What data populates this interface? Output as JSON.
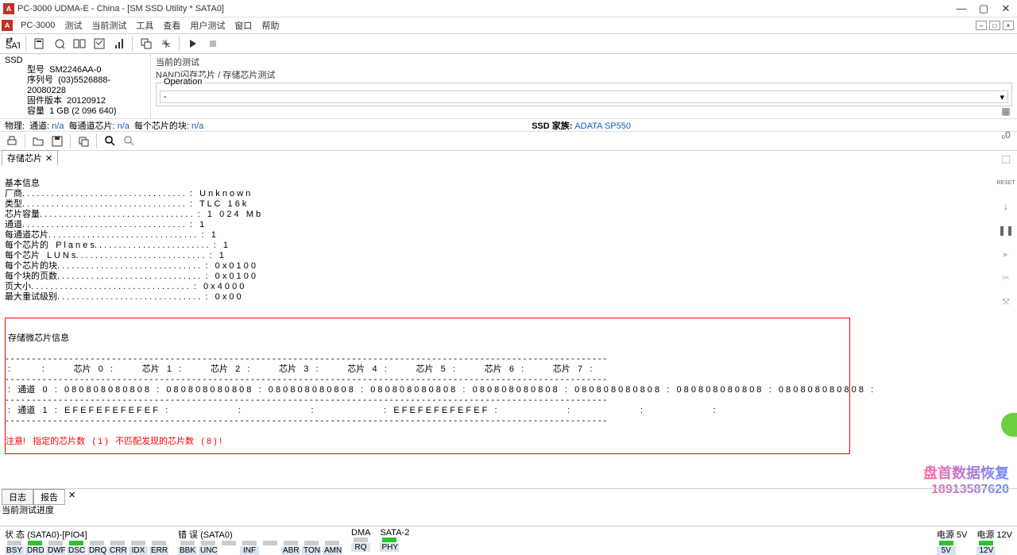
{
  "window": {
    "title": "PC-3000 UDMA-E - China - [SM SSD Utility * SATA0]",
    "minimize": "—",
    "maximize": "▢",
    "close": "✕"
  },
  "menu": {
    "app": "PC-3000",
    "items": [
      "测试",
      "当前测试",
      "工具",
      "查看",
      "用户测试",
      "窗口",
      "帮助"
    ]
  },
  "ssd_panel": {
    "label": "SSD",
    "model_k": "型号",
    "model_v": "SM2246AA-0",
    "serial_k": "序列号",
    "serial_v": "(03)5526888-20080228",
    "fw_k": "固件版本",
    "fw_v": "20120912",
    "cap_k": "容量",
    "cap_v": "1 GB (2 096 640)"
  },
  "right_panel": {
    "current_test": "当前的测试",
    "path": "NAND闪存芯片 / 存储芯片测试",
    "operation": "Operation",
    "op_val": "-"
  },
  "phys": {
    "label": "物理:",
    "ch": "通道:",
    "ch_v": "n/a",
    "per": "每通道芯片:",
    "per_v": "n/a",
    "blk": "每个芯片的块:",
    "blk_v": "n/a",
    "ssd_family": "SSD 家族:",
    "family_link": "ADATA SP550"
  },
  "tab": {
    "name": "存储芯片",
    "x": "✕"
  },
  "console": {
    "header": "基本信息",
    "lines": [
      "厂商. . . . . . . . . . . . . . . . . . . . . . . . . . . . . . . . . .  :   U n k n o w n",
      "类型. . . . . . . . . . . . . . . . . . . . . . . . . . . . . . . . . .  :   T L C   1 6 k",
      "芯片容量. . . . . . . . . . . . . . . . . . . . . . . . . . . . . . . .  :   1   0 2 4   M b",
      "通道. . . . . . . . . . . . . . . . . . . . . . . . . . . . . . . . . .  :   1",
      "每通道芯片. . . . . . . . . . . . . . . . . . . . . . . . . . . . . . .  :   1",
      "每个芯片的   P l a n e s. . . . . . . . . . . . . . . . . . . . . . . .  :   1",
      "每个芯片   L U N s. . . . . . . . . . . . . . . . . . . . . . . . . . .  :   1",
      "每个芯片的块. . . . . . . . . . . . . . . . . . . . . . . . . . . . . .  :   0 x 0 1 0 0",
      "每个块的页数. . . . . . . . . . . . . . . . . . . . . . . . . . . . . .  :   0 x 0 1 0 0",
      "页大小. . . . . . . . . . . . . . . . . . . . . . . . . . . . . . . . .  :   0 x 4 0 0 0",
      "最大重试级别. . . . . . . . . . . . . . . . . . . . . . . . . . . . . .  :   0 x 0 0"
    ],
    "box_title": "存储微芯片信息",
    "box_lines": [
      "- - - - - - - - - - - - - - - - - - - - - - - - - - - - - - - - - - - - - - - - - - - - - - - - - - - - - - - - - - - - - - - - - - - - - - - - - - - - - - - - - - - - - - - - - - - - - - - - - - - - - - - - - - - - - - - - -",
      " :             :            芯片   0   :            芯片   1   :            芯片   2   :            芯片   3   :            芯片   4   :            芯片   5   :            芯片   6   :            芯片   7   :",
      "- - - - - - - - - - - - - - - - - - - - - - - - - - - - - - - - - - - - - - - - - - - - - - - - - - - - - - - - - - - - - - - - - - - - - - - - - - - - - - - - - - - - - - - - - - - - - - - - - - - - - - - - - - - - - - - - -",
      " :   通道   0   :   0 8 0 8 0 8 0 8 0 8 0 8   :   0 8 0 8 0 8 0 8 0 8 0 8   :   0 8 0 8 0 8 0 8 0 8 0 8   :   0 8 0 8 0 8 0 8 0 8 0 8   :   0 8 0 8 0 8 0 8 0 8 0 8   :   0 8 0 8 0 8 0 8 0 8 0 8   :   0 8 0 8 0 8 0 8 0 8 0 8   :   0 8 0 8 0 8 0 8 0 8 0 8   :",
      "- - - - - - - - - - - - - - - - - - - - - - - - - - - - - - - - - - - - - - - - - - - - - - - - - - - - - - - - - - - - - - - - - - - - - - - - - - - - - - - - - - - - - - - - - - - - - - - - - - - - - - - - - - - - - - - - -",
      " :   通道   1   :   E F E F E F E F E F E F   :                             :                             :                             :   E F E F E F E F E F E F   :                             :                             :                             :",
      "- - - - - - - - - - - - - - - - - - - - - - - - - - - - - - - - - - - - - - - - - - - - - - - - - - - - - - - - - - - - - - - - - - - - - - - - - - - - - - - - - - - - - - - - - - - - - - - - - - - - - - - - - - - - - - - - -"
    ],
    "warning": "注意!   指定的芯片数   ( 1 )   不匹配发现的芯片数   ( 8 ) !"
  },
  "bottom_tabs": {
    "log": "日志",
    "report": "报告",
    "x": "✕"
  },
  "progress": "当前测试进度",
  "status": {
    "g1_title": "状 态 (SATA0)-[PIO4]",
    "g1": [
      "BSY",
      "DRD",
      "DWF",
      "DSC",
      "DRQ",
      "CRR",
      "IDX",
      "ERR"
    ],
    "g1_on": [
      false,
      true,
      false,
      true,
      false,
      false,
      false,
      false
    ],
    "g2_title": "错 误 (SATA0)",
    "g2": [
      "BBK",
      "UNC",
      "",
      "INF",
      "",
      "ABR",
      "TON",
      "AMN"
    ],
    "g2_on": [
      false,
      false,
      false,
      false,
      false,
      false,
      false,
      false
    ],
    "g3_title": "DMA",
    "g3": [
      "RQ"
    ],
    "g3_on": [
      false
    ],
    "g4_title": "SATA-2",
    "g4": [
      "PHY"
    ],
    "g4_on": [
      true
    ],
    "g5_title": "电源 5V",
    "g5": [
      "5V"
    ],
    "g5_on": [
      true
    ],
    "g6_title": "电源 12V",
    "g6": [
      "12V"
    ],
    "g6_on": [
      true
    ]
  },
  "watermark": {
    "l1": "盘首数据恢复",
    "l2": "18913587620"
  }
}
